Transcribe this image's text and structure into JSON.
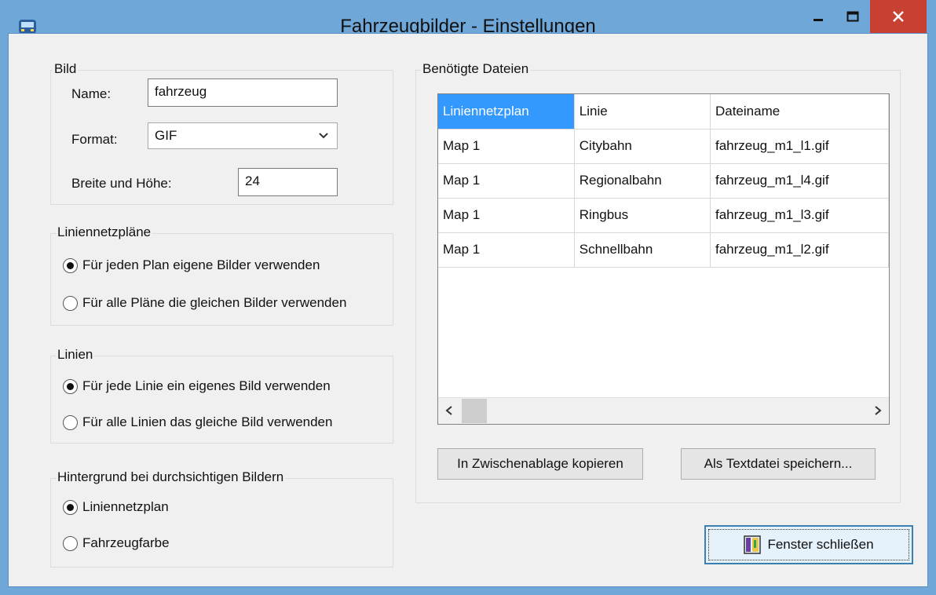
{
  "window": {
    "title": "Fahrzeugbilder - Einstellungen",
    "icons": {
      "app": "bus-icon",
      "minimize": "minimize-icon",
      "maximize": "maximize-icon",
      "close": "close-icon"
    }
  },
  "bild": {
    "legend": "Bild",
    "name_label": "Name:",
    "name_value": "fahrzeug",
    "format_label": "Format:",
    "format_value": "GIF",
    "size_label": "Breite und Höhe:",
    "size_value": "24"
  },
  "liniennetzplaene": {
    "legend": "Liniennetzpläne",
    "options": [
      {
        "label": "Für jeden Plan eigene Bilder verwenden",
        "checked": true
      },
      {
        "label": "Für alle Pläne die gleichen Bilder verwenden",
        "checked": false
      }
    ]
  },
  "linien": {
    "legend": "Linien",
    "options": [
      {
        "label": "Für jede Linie ein eigenes Bild verwenden",
        "checked": true
      },
      {
        "label": "Für alle Linien das gleiche Bild verwenden",
        "checked": false
      }
    ]
  },
  "hintergrund": {
    "legend": "Hintergrund bei durchsichtigen Bildern",
    "options": [
      {
        "label": "Liniennetzplan",
        "checked": true
      },
      {
        "label": "Fahrzeugfarbe",
        "checked": false
      }
    ]
  },
  "dateien": {
    "legend": "Benötigte Dateien",
    "columns": [
      "Liniennetzplan",
      "Linie",
      "Dateiname"
    ],
    "rows": [
      [
        "Map 1",
        "Citybahn",
        "fahrzeug_m1_l1.gif"
      ],
      [
        "Map 1",
        "Regionalbahn",
        "fahrzeug_m1_l4.gif"
      ],
      [
        "Map 1",
        "Ringbus",
        "fahrzeug_m1_l3.gif"
      ],
      [
        "Map 1",
        "Schnellbahn",
        "fahrzeug_m1_l2.gif"
      ]
    ],
    "copy_button": "In Zwischenablage kopieren",
    "save_button": "Als Textdatei speichern..."
  },
  "close_button": "Fenster schließen",
  "colors": {
    "selection": "#3399ff",
    "titlebar": "#6fa7d8",
    "close": "#c84031"
  }
}
